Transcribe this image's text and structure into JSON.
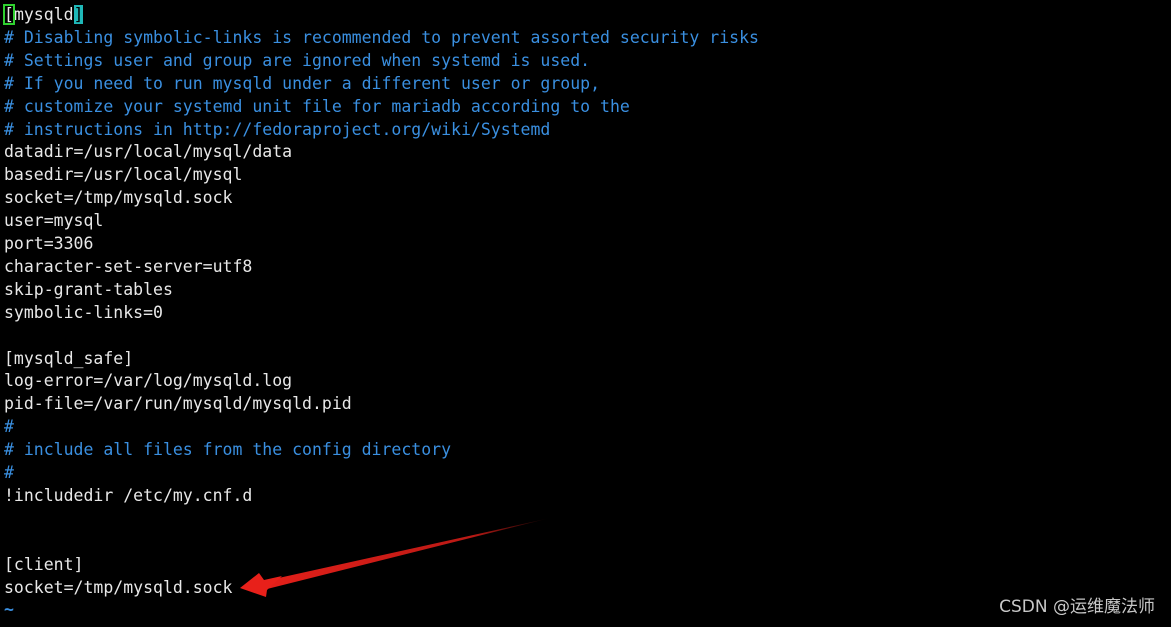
{
  "editor": {
    "section_open_bracket": "[",
    "section_name": "mysqld",
    "section_close_bracket": "]",
    "lines": [
      {
        "text": "# Disabling symbolic-links is recommended to prevent assorted security risks",
        "type": "comment"
      },
      {
        "text": "# Settings user and group are ignored when systemd is used.",
        "type": "comment"
      },
      {
        "text": "# If you need to run mysqld under a different user or group,",
        "type": "comment"
      },
      {
        "text": "# customize your systemd unit file for mariadb according to the",
        "type": "comment"
      },
      {
        "text": "# instructions in http://fedoraproject.org/wiki/Systemd",
        "type": "comment"
      },
      {
        "text": "datadir=/usr/local/mysql/data",
        "type": "text"
      },
      {
        "text": "basedir=/usr/local/mysql",
        "type": "text"
      },
      {
        "text": "socket=/tmp/mysqld.sock",
        "type": "text"
      },
      {
        "text": "user=mysql",
        "type": "text"
      },
      {
        "text": "port=3306",
        "type": "text"
      },
      {
        "text": "character-set-server=utf8",
        "type": "text"
      },
      {
        "text": "skip-grant-tables",
        "type": "text"
      },
      {
        "text": "symbolic-links=0",
        "type": "text"
      },
      {
        "text": "",
        "type": "text"
      },
      {
        "text": "[mysqld_safe]",
        "type": "text"
      },
      {
        "text": "log-error=/var/log/mysqld.log",
        "type": "text"
      },
      {
        "text": "pid-file=/var/run/mysqld/mysqld.pid",
        "type": "text"
      },
      {
        "text": "#",
        "type": "comment"
      },
      {
        "text": "# include all files from the config directory",
        "type": "comment"
      },
      {
        "text": "#",
        "type": "comment"
      },
      {
        "text": "!includedir /etc/my.cnf.d",
        "type": "text"
      },
      {
        "text": "",
        "type": "text"
      },
      {
        "text": "",
        "type": "text"
      },
      {
        "text": "[client]",
        "type": "text"
      },
      {
        "text": "socket=/tmp/mysqld.sock",
        "type": "text"
      },
      {
        "text": "~",
        "type": "tilde"
      }
    ]
  },
  "annotation": {
    "arrow_color": "#e8201a"
  },
  "watermark": "CSDN @运维魔法师"
}
